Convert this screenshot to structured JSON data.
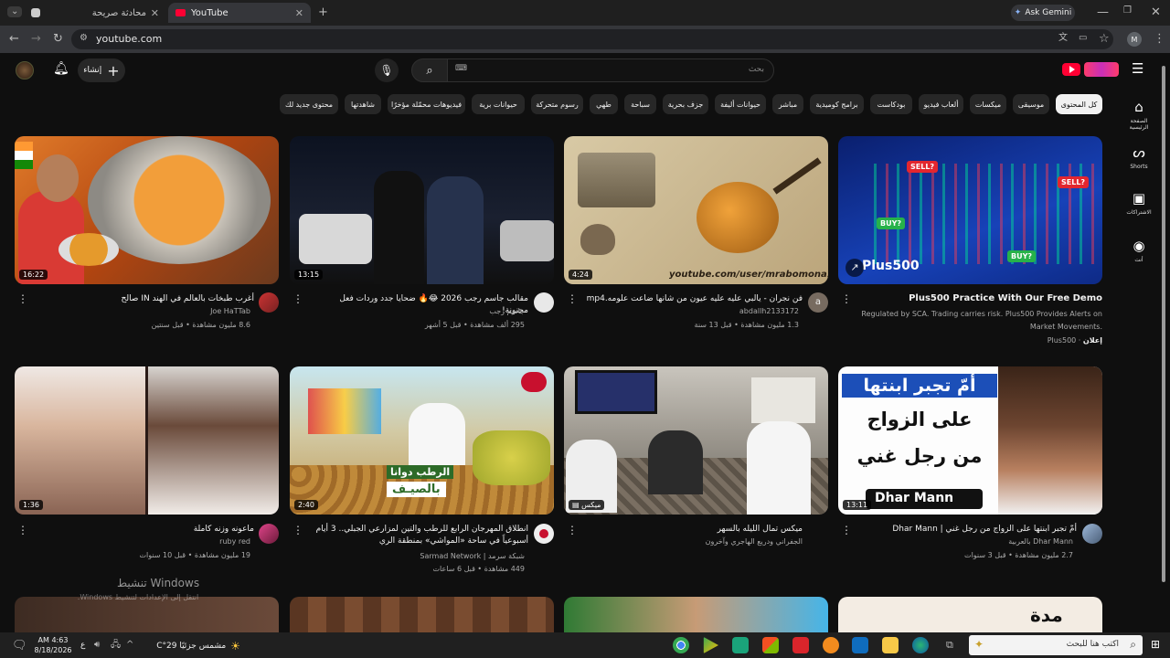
{
  "browser": {
    "tabs": [
      {
        "title": "محادثة صريحة"
      },
      {
        "title": "YouTube"
      }
    ],
    "url": "youtube.com",
    "ask_gemini": "Ask Gemini",
    "profile_initial": "M"
  },
  "header": {
    "create_label": "إنشاء",
    "search_placeholder": "بحث"
  },
  "chips": [
    {
      "label": "كل المحتوى",
      "active": true
    },
    {
      "label": "موسيقى"
    },
    {
      "label": "ميكسات"
    },
    {
      "label": "ألعاب فيديو"
    },
    {
      "label": "بودكاست"
    },
    {
      "label": "برامج كوميدية"
    },
    {
      "label": "مباشر"
    },
    {
      "label": "حيوانات أليفة"
    },
    {
      "label": "جزف بحرية"
    },
    {
      "label": "سباحة"
    },
    {
      "label": "طهي"
    },
    {
      "label": "رسوم متحركة"
    },
    {
      "label": "حيوانات برية"
    },
    {
      "label": "فيديوهات محمّلة مؤخرًا"
    },
    {
      "label": "شاهدتها"
    },
    {
      "label": "محتوى جديد لك"
    }
  ],
  "nav": [
    {
      "label": "الصفحة الرئيسية"
    },
    {
      "label": "Shorts"
    },
    {
      "label": "الاشتراكات"
    },
    {
      "label": "أنت"
    }
  ],
  "videos": [
    {
      "title": "Plus500 Practice With Our Free Demo",
      "desc": "Regulated by SCA. Trading carries risk. Plus500 Provides Alerts on Market Movements.",
      "channel": "Plus500",
      "ad_label": "إعلان",
      "thumb_text": "Plus500",
      "sell": "SELL?",
      "buy": "BUY?"
    },
    {
      "title": "فن نجران - يالبي عليه عليه عيون من شانها ضاعت علومه.mp4",
      "channel": "abdallh2133172",
      "views": "1.3 مليون مشاهدة",
      "age": "قبل 13 سنة",
      "duration": "4:24",
      "avatar": "a",
      "thumb_text": "youtube.com/user/mrabomona1"
    },
    {
      "title": "مقالب جاسم رجب 2026 😂🔥 ضحايا جدد وردات فعل مجنونة!",
      "channel": "جاسم رجب",
      "views": "295 ألف مشاهدة",
      "age": "قبل 5 أشهر",
      "duration": "13:15"
    },
    {
      "title": "أغرب طبخات بالعالم في الهند IN صالح",
      "channel": "Joe HaTTab",
      "views": "8.6 مليون مشاهدة",
      "age": "قبل سنتين",
      "duration": "16:22"
    },
    {
      "title": "أمّ تجبر ابنتها على الزواج من رجل غني | Dhar Mann",
      "channel": "Dhar Mann بالعربية",
      "views": "2.7 مليون مشاهدة",
      "age": "قبل 3 سنوات",
      "duration": "13:11",
      "thumb_line1": "أمّ تجبر ابنتها",
      "thumb_line2": "على الزواج",
      "thumb_line3": "من رجل غني",
      "thumb_brand": "Dhar Mann"
    },
    {
      "title": "ميكس تمال الليله بالسهر",
      "channel": "الجفراني ودريع الهاجري وآخرون",
      "views": "",
      "age": "",
      "duration": "ميكس"
    },
    {
      "title": "انطلاق المهرجان الرابع للرطب والتين لمزارعي الجبلي.. 3 أيام أسبوعياً في ساحة «المواشي» بمنطقة الري",
      "channel": "شبكة سرمد | Sarmad Network",
      "views": "449 مشاهدة",
      "age": "قبل 6 ساعات",
      "duration": "2:40",
      "thumb_text1": "الرطب دوانا",
      "thumb_text2": "بالصيـف"
    },
    {
      "title": "ماعونه وزنه كاملة",
      "channel": "ruby red",
      "views": "19 مليون مشاهدة",
      "age": "قبل 10 سنوات",
      "duration": "1:36"
    }
  ],
  "windows": {
    "activate_title": "تنشيط Windows",
    "activate_sub": "انتقل إلى الإعدادات لتنشيط Windows."
  },
  "taskbar": {
    "search_placeholder": "اكتب هنا للبحث",
    "weather": "مشمس جزئيًا 29°C",
    "time": "AM 4:63",
    "date": "8/18/2026",
    "lang": "ع",
    "thumb_word": "مدة"
  },
  "colors": {
    "accent_red": "#ff0033",
    "chip_active": "#f1f1f1",
    "background": "#0f0f0f"
  }
}
